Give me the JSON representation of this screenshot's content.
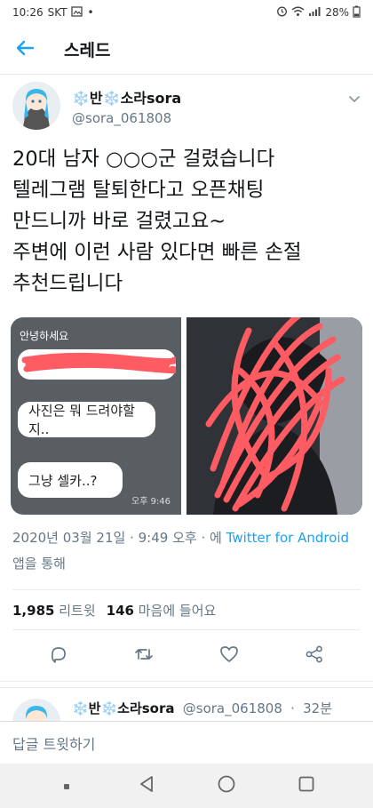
{
  "status": {
    "time": "10:26",
    "carrier": "SKT",
    "battery": "28%"
  },
  "header": {
    "title": "스레드"
  },
  "tweet": {
    "display_name": "❄️반❄️소라sora",
    "handle": "@sora_061808",
    "text": "20대 남자 ○○○군 걸렸습니다\n텔레그램 탈퇴한다고 오픈채팅\n만드니까 바로 걸렸고요~\n주변에 이런 사람 있다면 빠른 손절\n추천드립니다",
    "image_chat": {
      "greeting": "안녕하세요",
      "bubble_1": "사진은 뭐 드려야할지..",
      "bubble_2": "그냥 셀카..?",
      "chat_time": "오후 9:46"
    },
    "date": "2020년 03월 21일",
    "time": "9:49 오후",
    "via_prefix": "에",
    "via_app": "Twitter for Android",
    "via_suffix": "앱을 통해",
    "retweet_count": "1,985",
    "retweet_label": "리트윗",
    "like_count": "146",
    "like_label": "마음에 들어요"
  },
  "reply_preview": {
    "display_name": "❄️반❄️소라sora",
    "handle": "@sora_061808",
    "age": "32분"
  },
  "compose": {
    "placeholder": "답글 트윗하기"
  },
  "icons": {
    "back": "arrow-left-icon",
    "caret": "chevron-down-icon",
    "reply": "comment-icon",
    "retweet": "retweet-icon",
    "like": "heart-icon",
    "share": "share-icon"
  },
  "colors": {
    "accent": "#1da1f2",
    "secondary_text": "#657786",
    "redaction": "#ff5b63"
  }
}
